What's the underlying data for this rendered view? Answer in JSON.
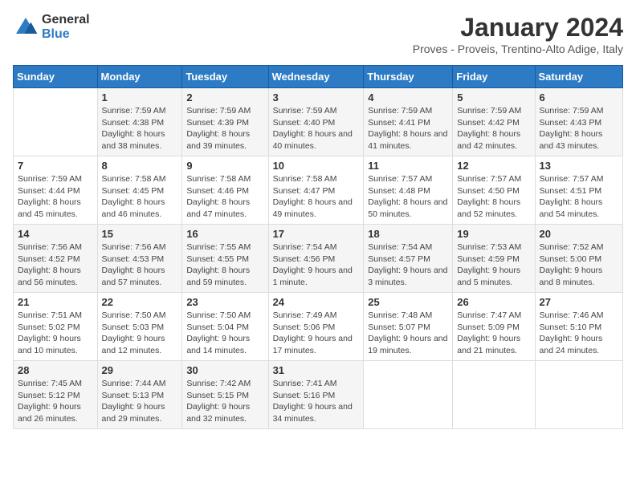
{
  "logo": {
    "general": "General",
    "blue": "Blue"
  },
  "title": "January 2024",
  "location": "Proves - Proveis, Trentino-Alto Adige, Italy",
  "weekdays": [
    "Sunday",
    "Monday",
    "Tuesday",
    "Wednesday",
    "Thursday",
    "Friday",
    "Saturday"
  ],
  "weeks": [
    [
      {
        "day": "",
        "sunrise": "",
        "sunset": "",
        "daylight": ""
      },
      {
        "day": "1",
        "sunrise": "Sunrise: 7:59 AM",
        "sunset": "Sunset: 4:38 PM",
        "daylight": "Daylight: 8 hours and 38 minutes."
      },
      {
        "day": "2",
        "sunrise": "Sunrise: 7:59 AM",
        "sunset": "Sunset: 4:39 PM",
        "daylight": "Daylight: 8 hours and 39 minutes."
      },
      {
        "day": "3",
        "sunrise": "Sunrise: 7:59 AM",
        "sunset": "Sunset: 4:40 PM",
        "daylight": "Daylight: 8 hours and 40 minutes."
      },
      {
        "day": "4",
        "sunrise": "Sunrise: 7:59 AM",
        "sunset": "Sunset: 4:41 PM",
        "daylight": "Daylight: 8 hours and 41 minutes."
      },
      {
        "day": "5",
        "sunrise": "Sunrise: 7:59 AM",
        "sunset": "Sunset: 4:42 PM",
        "daylight": "Daylight: 8 hours and 42 minutes."
      },
      {
        "day": "6",
        "sunrise": "Sunrise: 7:59 AM",
        "sunset": "Sunset: 4:43 PM",
        "daylight": "Daylight: 8 hours and 43 minutes."
      }
    ],
    [
      {
        "day": "7",
        "sunrise": "Sunrise: 7:59 AM",
        "sunset": "Sunset: 4:44 PM",
        "daylight": "Daylight: 8 hours and 45 minutes."
      },
      {
        "day": "8",
        "sunrise": "Sunrise: 7:58 AM",
        "sunset": "Sunset: 4:45 PM",
        "daylight": "Daylight: 8 hours and 46 minutes."
      },
      {
        "day": "9",
        "sunrise": "Sunrise: 7:58 AM",
        "sunset": "Sunset: 4:46 PM",
        "daylight": "Daylight: 8 hours and 47 minutes."
      },
      {
        "day": "10",
        "sunrise": "Sunrise: 7:58 AM",
        "sunset": "Sunset: 4:47 PM",
        "daylight": "Daylight: 8 hours and 49 minutes."
      },
      {
        "day": "11",
        "sunrise": "Sunrise: 7:57 AM",
        "sunset": "Sunset: 4:48 PM",
        "daylight": "Daylight: 8 hours and 50 minutes."
      },
      {
        "day": "12",
        "sunrise": "Sunrise: 7:57 AM",
        "sunset": "Sunset: 4:50 PM",
        "daylight": "Daylight: 8 hours and 52 minutes."
      },
      {
        "day": "13",
        "sunrise": "Sunrise: 7:57 AM",
        "sunset": "Sunset: 4:51 PM",
        "daylight": "Daylight: 8 hours and 54 minutes."
      }
    ],
    [
      {
        "day": "14",
        "sunrise": "Sunrise: 7:56 AM",
        "sunset": "Sunset: 4:52 PM",
        "daylight": "Daylight: 8 hours and 56 minutes."
      },
      {
        "day": "15",
        "sunrise": "Sunrise: 7:56 AM",
        "sunset": "Sunset: 4:53 PM",
        "daylight": "Daylight: 8 hours and 57 minutes."
      },
      {
        "day": "16",
        "sunrise": "Sunrise: 7:55 AM",
        "sunset": "Sunset: 4:55 PM",
        "daylight": "Daylight: 8 hours and 59 minutes."
      },
      {
        "day": "17",
        "sunrise": "Sunrise: 7:54 AM",
        "sunset": "Sunset: 4:56 PM",
        "daylight": "Daylight: 9 hours and 1 minute."
      },
      {
        "day": "18",
        "sunrise": "Sunrise: 7:54 AM",
        "sunset": "Sunset: 4:57 PM",
        "daylight": "Daylight: 9 hours and 3 minutes."
      },
      {
        "day": "19",
        "sunrise": "Sunrise: 7:53 AM",
        "sunset": "Sunset: 4:59 PM",
        "daylight": "Daylight: 9 hours and 5 minutes."
      },
      {
        "day": "20",
        "sunrise": "Sunrise: 7:52 AM",
        "sunset": "Sunset: 5:00 PM",
        "daylight": "Daylight: 9 hours and 8 minutes."
      }
    ],
    [
      {
        "day": "21",
        "sunrise": "Sunrise: 7:51 AM",
        "sunset": "Sunset: 5:02 PM",
        "daylight": "Daylight: 9 hours and 10 minutes."
      },
      {
        "day": "22",
        "sunrise": "Sunrise: 7:50 AM",
        "sunset": "Sunset: 5:03 PM",
        "daylight": "Daylight: 9 hours and 12 minutes."
      },
      {
        "day": "23",
        "sunrise": "Sunrise: 7:50 AM",
        "sunset": "Sunset: 5:04 PM",
        "daylight": "Daylight: 9 hours and 14 minutes."
      },
      {
        "day": "24",
        "sunrise": "Sunrise: 7:49 AM",
        "sunset": "Sunset: 5:06 PM",
        "daylight": "Daylight: 9 hours and 17 minutes."
      },
      {
        "day": "25",
        "sunrise": "Sunrise: 7:48 AM",
        "sunset": "Sunset: 5:07 PM",
        "daylight": "Daylight: 9 hours and 19 minutes."
      },
      {
        "day": "26",
        "sunrise": "Sunrise: 7:47 AM",
        "sunset": "Sunset: 5:09 PM",
        "daylight": "Daylight: 9 hours and 21 minutes."
      },
      {
        "day": "27",
        "sunrise": "Sunrise: 7:46 AM",
        "sunset": "Sunset: 5:10 PM",
        "daylight": "Daylight: 9 hours and 24 minutes."
      }
    ],
    [
      {
        "day": "28",
        "sunrise": "Sunrise: 7:45 AM",
        "sunset": "Sunset: 5:12 PM",
        "daylight": "Daylight: 9 hours and 26 minutes."
      },
      {
        "day": "29",
        "sunrise": "Sunrise: 7:44 AM",
        "sunset": "Sunset: 5:13 PM",
        "daylight": "Daylight: 9 hours and 29 minutes."
      },
      {
        "day": "30",
        "sunrise": "Sunrise: 7:42 AM",
        "sunset": "Sunset: 5:15 PM",
        "daylight": "Daylight: 9 hours and 32 minutes."
      },
      {
        "day": "31",
        "sunrise": "Sunrise: 7:41 AM",
        "sunset": "Sunset: 5:16 PM",
        "daylight": "Daylight: 9 hours and 34 minutes."
      },
      {
        "day": "",
        "sunrise": "",
        "sunset": "",
        "daylight": ""
      },
      {
        "day": "",
        "sunrise": "",
        "sunset": "",
        "daylight": ""
      },
      {
        "day": "",
        "sunrise": "",
        "sunset": "",
        "daylight": ""
      }
    ]
  ]
}
